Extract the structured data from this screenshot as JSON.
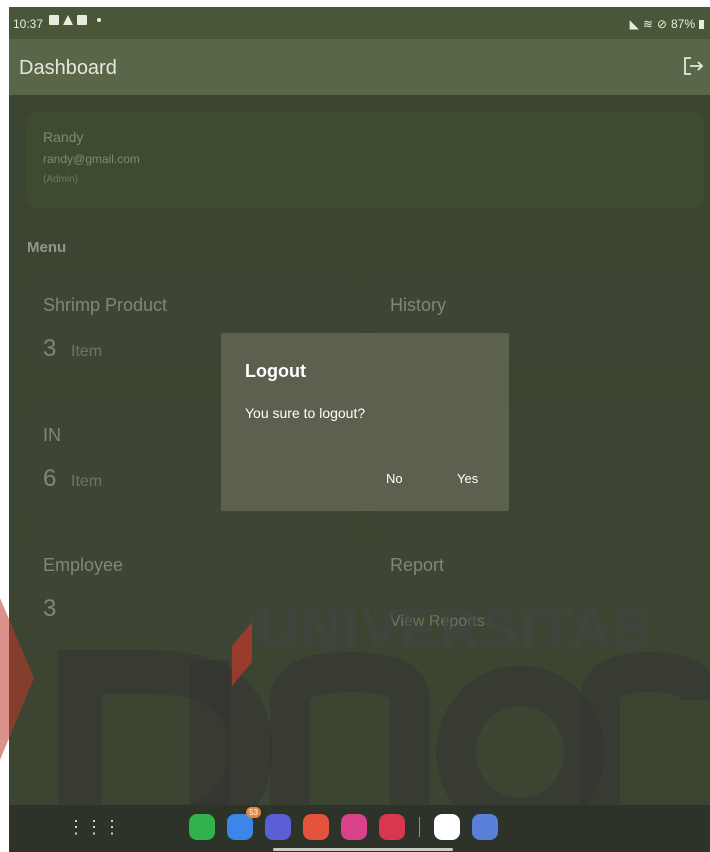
{
  "status_bar": {
    "time": "10:37",
    "battery": "87%"
  },
  "app_bar": {
    "title": "Dashboard",
    "logout_icon": "logout-icon"
  },
  "profile": {
    "name": "Randy",
    "email": "randy@gmail.com",
    "role": "(Admin)"
  },
  "menu": {
    "title": "Menu",
    "cards": [
      {
        "title": "Shrimp Product",
        "value": "3",
        "unit": "Item"
      },
      {
        "title": "History",
        "value": "",
        "unit": ""
      },
      {
        "title": "IN",
        "value": "6",
        "unit": "Item"
      },
      {
        "title": "",
        "value": "",
        "unit": ""
      },
      {
        "title": "Employee",
        "value": "3",
        "unit": ""
      },
      {
        "title": "Report",
        "value": "",
        "unit": "View Reports"
      }
    ]
  },
  "dialog": {
    "title": "Logout",
    "message": "You sure to logout?",
    "no_label": "No",
    "yes_label": "Yes"
  },
  "watermark": {
    "line1": "UNIVERSITAS",
    "line2": "Dinamika"
  },
  "nav_bar": {
    "badge_count": "53"
  },
  "colors": {
    "background": "#5d6b4e",
    "card": "#5f6a52",
    "dialog": "#5b614e",
    "watermark_red": "#c0392b"
  }
}
